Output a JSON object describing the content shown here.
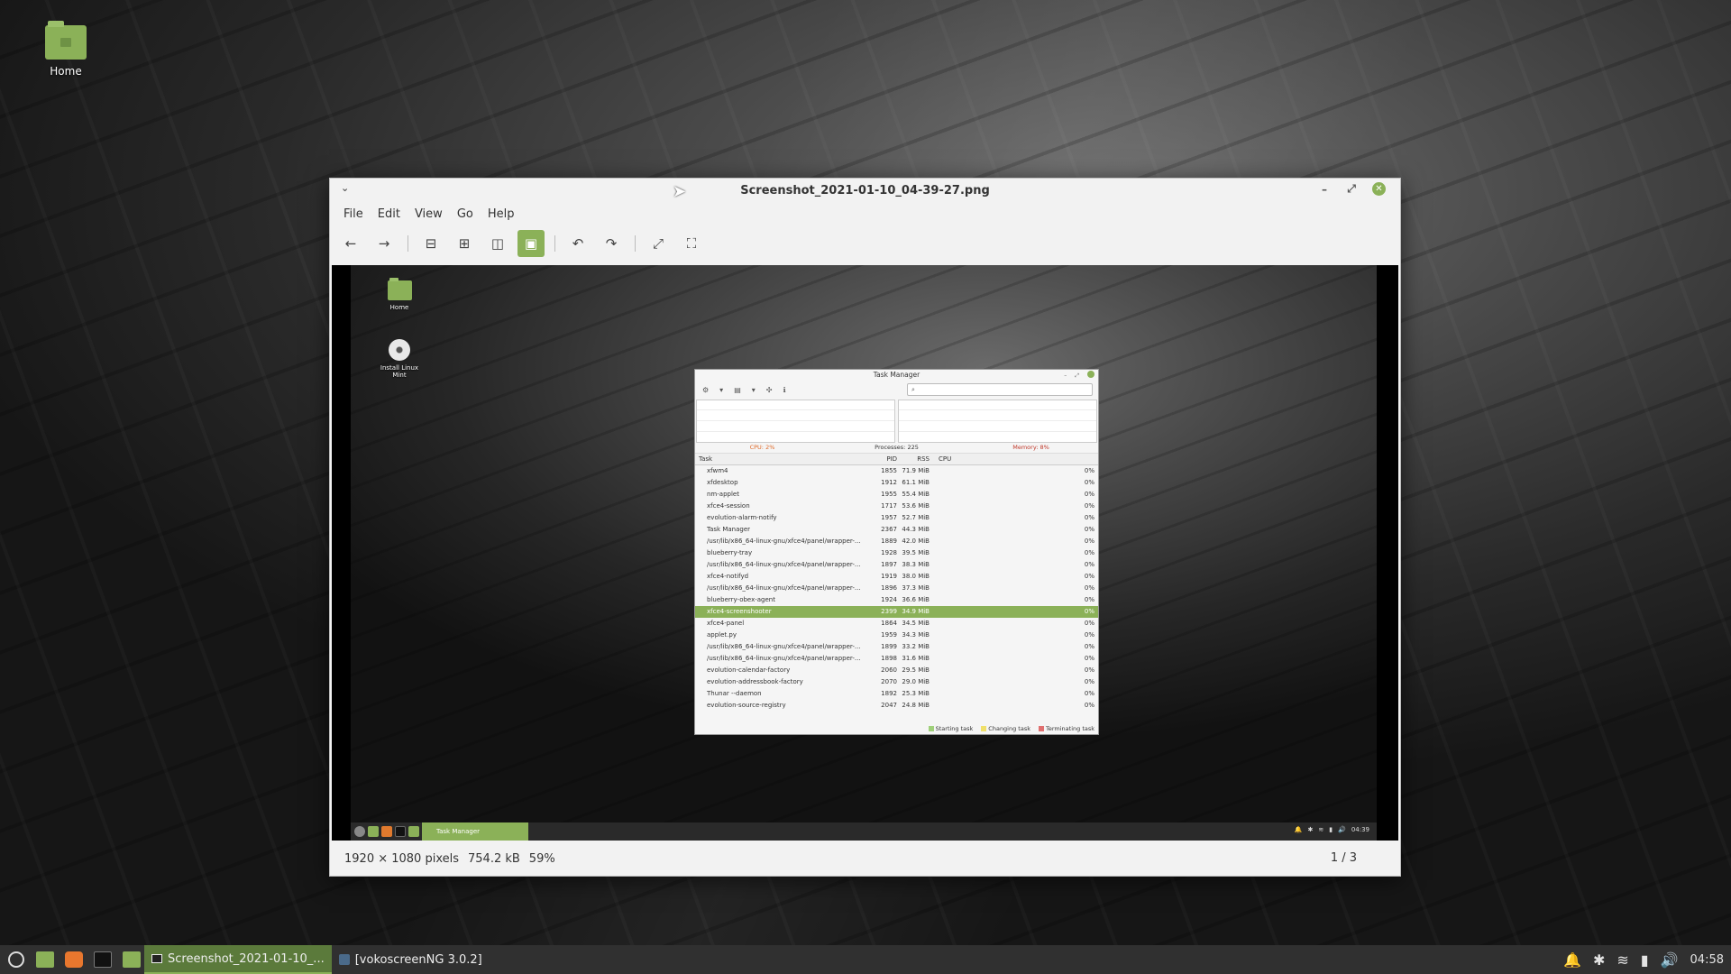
{
  "desktop": {
    "icons": [
      {
        "label": "Home"
      }
    ]
  },
  "window": {
    "title": "Screenshot_2021-01-10_04-39-27.png",
    "menu": [
      "File",
      "Edit",
      "View",
      "Go",
      "Help"
    ],
    "status": {
      "dimensions": "1920 × 1080 pixels",
      "filesize": "754.2 kB",
      "zoom": "59%",
      "pager": "1 / 3"
    }
  },
  "inner_screenshot": {
    "desktop_icons": [
      "Home",
      "Install Linux Mint"
    ],
    "task_manager": {
      "title": "Task Manager",
      "stats": {
        "cpu": "CPU: 2%",
        "processes": "Processes: 225",
        "memory": "Memory: 8%"
      },
      "columns": [
        "Task",
        "PID",
        "RSS",
        "CPU"
      ],
      "rows": [
        {
          "task": "xfwm4",
          "pid": "1855",
          "rss": "71.9 MiB",
          "cpu": "0%"
        },
        {
          "task": "xfdesktop",
          "pid": "1912",
          "rss": "61.1 MiB",
          "cpu": "0%"
        },
        {
          "task": "nm-applet",
          "pid": "1955",
          "rss": "55.4 MiB",
          "cpu": "0%"
        },
        {
          "task": "xfce4-session",
          "pid": "1717",
          "rss": "53.6 MiB",
          "cpu": "0%"
        },
        {
          "task": "evolution-alarm-notify",
          "pid": "1957",
          "rss": "52.7 MiB",
          "cpu": "0%"
        },
        {
          "task": "Task Manager",
          "pid": "2367",
          "rss": "44.3 MiB",
          "cpu": "0%"
        },
        {
          "task": "/usr/lib/x86_64-linux-gnu/xfce4/panel/wrapper-...",
          "pid": "1889",
          "rss": "42.0 MiB",
          "cpu": "0%"
        },
        {
          "task": "blueberry-tray",
          "pid": "1928",
          "rss": "39.5 MiB",
          "cpu": "0%"
        },
        {
          "task": "/usr/lib/x86_64-linux-gnu/xfce4/panel/wrapper-...",
          "pid": "1897",
          "rss": "38.3 MiB",
          "cpu": "0%"
        },
        {
          "task": "xfce4-notifyd",
          "pid": "1919",
          "rss": "38.0 MiB",
          "cpu": "0%"
        },
        {
          "task": "/usr/lib/x86_64-linux-gnu/xfce4/panel/wrapper-...",
          "pid": "1896",
          "rss": "37.3 MiB",
          "cpu": "0%"
        },
        {
          "task": "blueberry-obex-agent",
          "pid": "1924",
          "rss": "36.6 MiB",
          "cpu": "0%"
        },
        {
          "task": "xfce4-screenshooter",
          "pid": "2399",
          "rss": "34.9 MiB",
          "cpu": "0%",
          "selected": true
        },
        {
          "task": "xfce4-panel",
          "pid": "1864",
          "rss": "34.5 MiB",
          "cpu": "0%"
        },
        {
          "task": "applet.py",
          "pid": "1959",
          "rss": "34.3 MiB",
          "cpu": "0%"
        },
        {
          "task": "/usr/lib/x86_64-linux-gnu/xfce4/panel/wrapper-...",
          "pid": "1899",
          "rss": "33.2 MiB",
          "cpu": "0%"
        },
        {
          "task": "/usr/lib/x86_64-linux-gnu/xfce4/panel/wrapper-...",
          "pid": "1898",
          "rss": "31.6 MiB",
          "cpu": "0%"
        },
        {
          "task": "evolution-calendar-factory",
          "pid": "2060",
          "rss": "29.5 MiB",
          "cpu": "0%"
        },
        {
          "task": "evolution-addressbook-factory",
          "pid": "2070",
          "rss": "29.0 MiB",
          "cpu": "0%"
        },
        {
          "task": "Thunar --daemon",
          "pid": "1892",
          "rss": "25.3 MiB",
          "cpu": "0%"
        },
        {
          "task": "evolution-source-registry",
          "pid": "2047",
          "rss": "24.8 MiB",
          "cpu": "0%"
        }
      ],
      "legend": [
        "Starting task",
        "Changing task",
        "Terminating task"
      ]
    },
    "panel": {
      "task_label": "Task Manager",
      "clock": "04:39"
    }
  },
  "taskbar": {
    "windows": [
      {
        "label": "Screenshot_2021-01-10_...",
        "active": true
      },
      {
        "label": "[vokoscreenNG 3.0.2]",
        "active": false
      }
    ],
    "clock": "04:58"
  },
  "colors": {
    "accent": "#8bb158",
    "panel": "#303030"
  }
}
